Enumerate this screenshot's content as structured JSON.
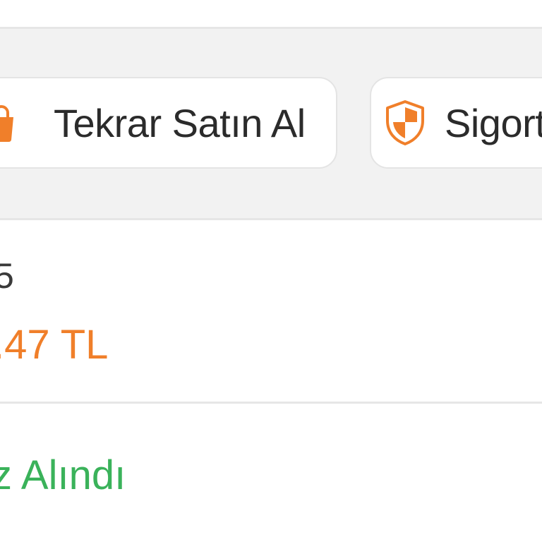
{
  "actions": {
    "rebuy_label": "Tekrar Satın Al",
    "insurance_label": "Sigort",
    "rebuy_icon": "shopping-bag-icon",
    "insurance_icon": "shield-icon"
  },
  "order_item": {
    "quantity_text": "5",
    "price_text": ".47 TL"
  },
  "status": {
    "text": "z Alındı"
  },
  "colors": {
    "accent_orange": "#f07f2a",
    "status_green": "#3ab25a",
    "background_gray": "#f2f2f2"
  }
}
